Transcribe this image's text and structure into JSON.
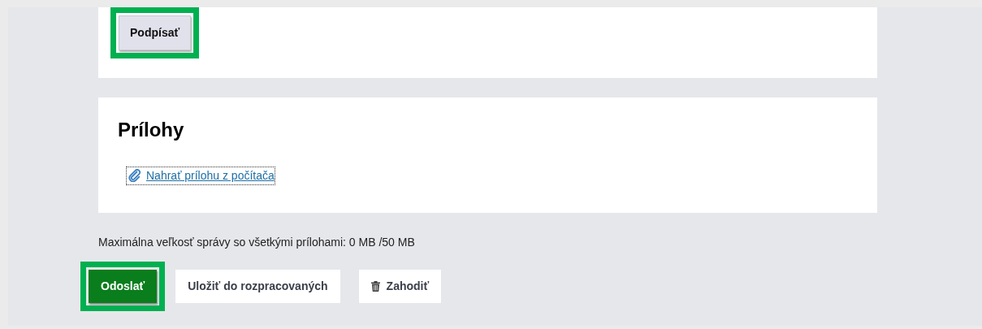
{
  "signature": {
    "button": {
      "label": "Podpísať",
      "highlighted": true
    }
  },
  "attachments": {
    "heading": "Prílohy",
    "upload_link": "Nahrať prílohu z počítača"
  },
  "size_note": "Maximálna veľkosť správy so všetkými prílohami: 0 MB /50 MB",
  "actions": [
    {
      "kind": "primary",
      "label": "Odoslať",
      "highlighted": true
    },
    {
      "kind": "secondary",
      "label": "Uložiť do rozpracovaných",
      "highlighted": false
    },
    {
      "kind": "trash",
      "label": "Zahodiť",
      "highlighted": false
    }
  ]
}
